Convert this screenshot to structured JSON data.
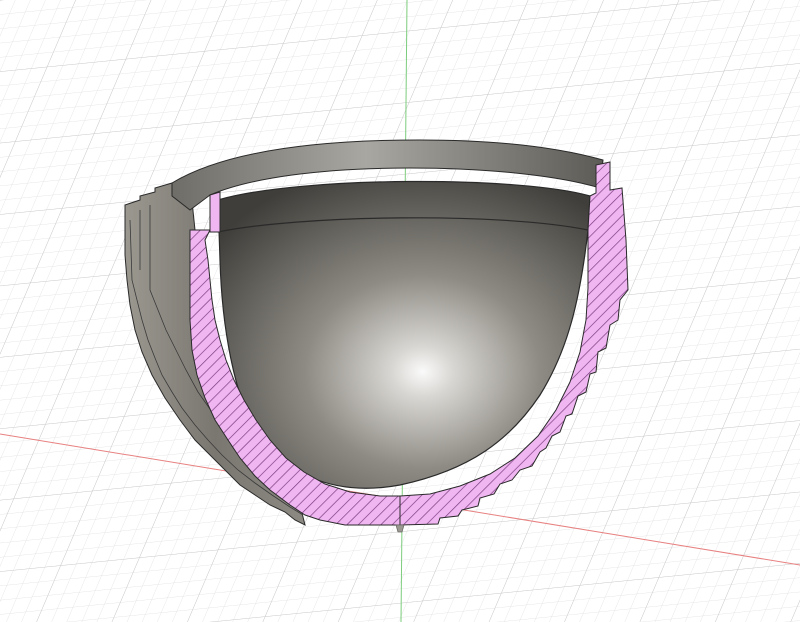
{
  "viewport": {
    "background_color": "#ffffff",
    "grid_minor_color": "#dcdcdc",
    "grid_major_color": "#c4c4c4",
    "x_axis_color": "#e88080",
    "y_axis_color": "#7ccc7c",
    "section_fill_color": "#f0b6f2",
    "section_hatch_color": "#7a3c7f",
    "outline_color": "#2a2a2a",
    "model": {
      "name": "sectioned-hemispherical-bowl",
      "outer_surface": "stepped",
      "view": "section-analysis"
    }
  }
}
